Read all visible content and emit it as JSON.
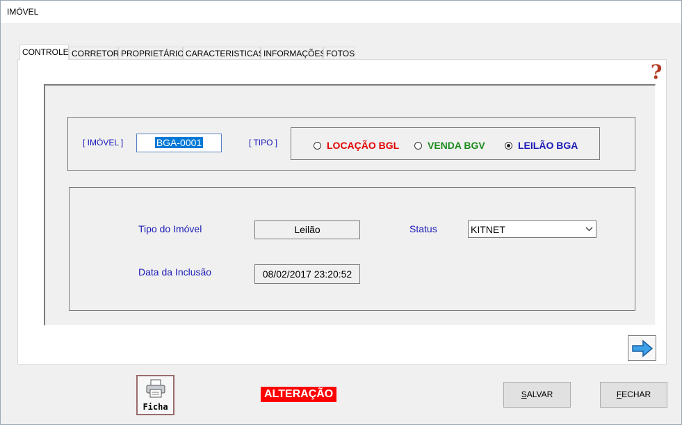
{
  "window": {
    "title": "IMÓVEL"
  },
  "tabs": [
    {
      "label": "CONTROLE",
      "active": true
    },
    {
      "label": "CORRETOR"
    },
    {
      "label": "PROPRIETÁRIO"
    },
    {
      "label": "CARACTERISTICAS"
    },
    {
      "label": "INFORMAÇÕES"
    },
    {
      "label": "FOTOS"
    }
  ],
  "help": {
    "icon": "question-icon",
    "glyph": "?"
  },
  "codigo": {
    "label": "[ IMÓVEL ]",
    "value": "BGA-0001"
  },
  "tipo": {
    "label": "[ TIPO ]",
    "options": [
      {
        "label": "LOCAÇÃO BGL",
        "color": "#e00000",
        "checked": false
      },
      {
        "label": "VENDA BGV",
        "color": "#1a8a1a",
        "checked": false
      },
      {
        "label": "LEILÃO BGA",
        "color": "#1a1ab8",
        "checked": true
      }
    ]
  },
  "details": {
    "tipo_imovel_label": "Tipo do Imóvel",
    "tipo_imovel_value": "Leilão",
    "status_label": "Status",
    "status_value": "KITNET",
    "data_inclusao_label": "Data da Inclusão",
    "data_inclusao_value": "08/02/2017 23:20:52"
  },
  "footer": {
    "ficha_label": "Ficha",
    "mode_badge": "ALTERAÇÃO",
    "salvar_first": "S",
    "salvar_rest": "ALVAR",
    "fechar_first": "F",
    "fechar_rest": "ECHAR"
  },
  "colors": {
    "accent_blue": "#1a1ab8",
    "badge_red": "#ff0000",
    "help_red": "#b33a22"
  }
}
